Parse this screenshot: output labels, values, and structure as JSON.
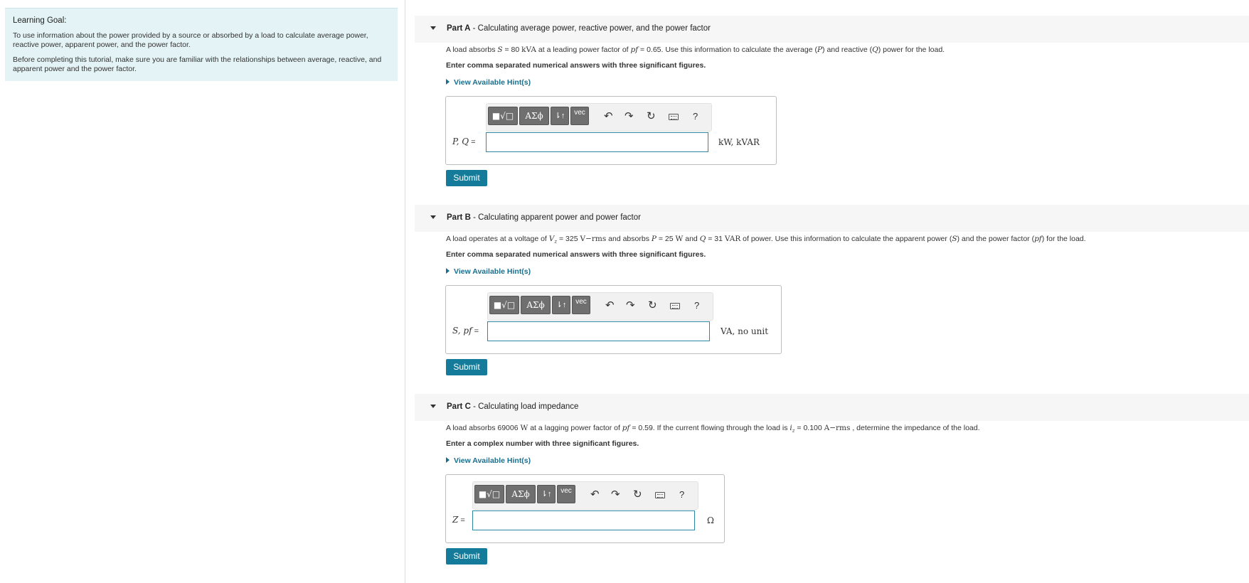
{
  "learning_goal": {
    "title": "Learning Goal:",
    "p1": "To use information about the power provided by a source or absorbed by a load to calculate  average power, reactive power, apparent power, and the power factor.",
    "p2": "Before completing this tutorial, make sure you are familiar with the relationships between average, reactive, and apparent power and the power factor."
  },
  "common": {
    "hint_label": "View Available Hint(s)",
    "submit_label": "Submit",
    "toolbar": {
      "templates": "■√□",
      "greek": "ΑΣϕ",
      "arrows": "⇂↑",
      "vec": "vec",
      "help": "?"
    }
  },
  "partA": {
    "letter": "Part A",
    "title": " - Calculating average power, reactive power, and the power factor",
    "problem": {
      "t1": "A load absorbs ",
      "v1": "S",
      "t2": " = 80 ",
      "u1": "kVA",
      "t3": " at a leading power factor of ",
      "v2": "pf",
      "t4": " = 0.65. Use this information to calculate the average (",
      "v3": "P",
      "t5": ") and reactive (",
      "v4": "Q",
      "t6": ") power for the load."
    },
    "instruction": "Enter comma separated numerical answers with three significant figures.",
    "var_label": "P, Q",
    "eq": " =",
    "units": "kW,  kVAR"
  },
  "partB": {
    "letter": "Part B",
    "title": " - Calculating apparent power and power factor",
    "problem": {
      "t1": "A load operates at a voltage of ",
      "v1": "V",
      "v1sub": "z",
      "t2": " = 325 ",
      "u1": "V−rms",
      "t3": " and absorbs ",
      "v2": "P",
      "t4": " = 25 ",
      "u2": "W",
      "t5": " and ",
      "v3": "Q",
      "t6": " = 31 ",
      "u3": "VAR",
      "t7": " of power. Use this information to calculate the apparent power (",
      "v4": "S",
      "t8": ") and the power factor (",
      "v5": "pf",
      "t9": ") for the load."
    },
    "instruction": "Enter comma separated numerical answers with three significant figures.",
    "var_label": "S, pf",
    "eq": " =",
    "units": "VA,  no unit"
  },
  "partC": {
    "letter": "Part C",
    "title": " - Calculating load impedance",
    "problem": {
      "t1": "A load absorbs 69006 ",
      "u1": "W",
      "t2": "  at a lagging power factor of ",
      "v1": "pf",
      "t3": " = 0.59. If the current flowing through the load is ",
      "v2": "i",
      "v2sub": "z",
      "t4": " = 0.100 ",
      "u2": "A−rms",
      "t5": " , determine the impedance of the load."
    },
    "instruction": "Enter a complex number with three significant figures.",
    "var_label": "Z",
    "eq": " =",
    "units": "Ω"
  }
}
